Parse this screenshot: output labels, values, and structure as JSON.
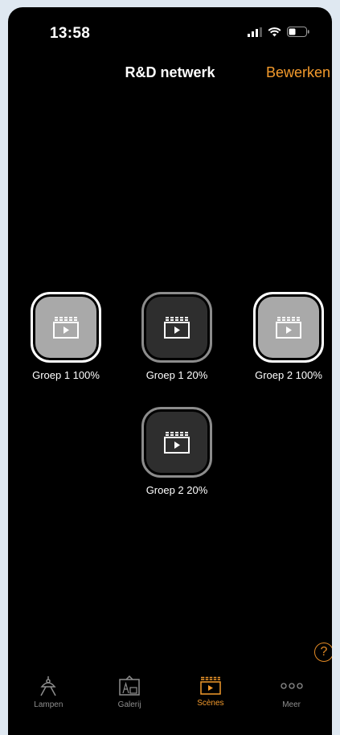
{
  "status": {
    "time": "13:58"
  },
  "header": {
    "title": "R&D netwerk",
    "edit_label": "Bewerken"
  },
  "scenes": [
    {
      "label": "Groep 1 100%",
      "style": "light"
    },
    {
      "label": "Groep 1 20%",
      "style": "dark"
    },
    {
      "label": "Groep 2 100%",
      "style": "light"
    },
    {
      "label": "Groep 2 20%",
      "style": "dark"
    }
  ],
  "help": {
    "glyph": "?"
  },
  "tabs": [
    {
      "label": "Lampen",
      "icon": "lamp-icon",
      "active": false
    },
    {
      "label": "Galerij",
      "icon": "gallery-icon",
      "active": false
    },
    {
      "label": "Scènes",
      "icon": "scene-clapper-icon",
      "active": true
    },
    {
      "label": "Meer",
      "icon": "more-dots-icon",
      "active": false
    }
  ],
  "colors": {
    "accent": "#f39a2c",
    "background": "#000000",
    "inactive": "#8e8e8e"
  }
}
